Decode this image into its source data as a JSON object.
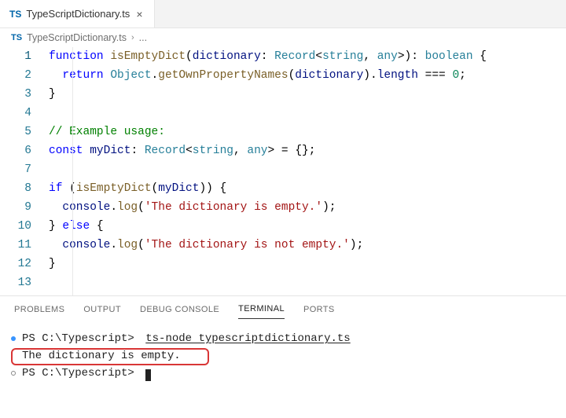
{
  "tab": {
    "icon_label": "TS",
    "filename": "TypeScriptDictionary.ts"
  },
  "breadcrumb": {
    "icon_label": "TS",
    "filename": "TypeScriptDictionary.ts",
    "tail": "..."
  },
  "gutter_lines": [
    "1",
    "2",
    "3",
    "4",
    "5",
    "6",
    "7",
    "8",
    "9",
    "10",
    "11",
    "12",
    "13"
  ],
  "code": {
    "l1": {
      "kw1": "function",
      "sp": " ",
      "fn": "isEmptyDict",
      "open": "(",
      "param": "dictionary",
      "colon": ": ",
      "typeA": "Record",
      "lt": "<",
      "str": "string",
      "comma": ", ",
      "any": "any",
      "gt": ">",
      "close": ")",
      "colon2": ": ",
      "ret": "boolean",
      "brace": " {"
    },
    "l2": {
      "indent": "  ",
      "kw": "return",
      "sp": " ",
      "obj": "Object",
      "dot": ".",
      "m1": "getOwnPropertyNames",
      "open": "(",
      "arg": "dictionary",
      "close": ")",
      "dot2": ".",
      "prop": "length",
      "eq": " === ",
      "num": "0",
      "semi": ";"
    },
    "l3": {
      "brace": "}"
    },
    "l5": {
      "comment": "// Example usage:"
    },
    "l6": {
      "kw": "const",
      "sp": " ",
      "name": "myDict",
      "colon": ": ",
      "typeA": "Record",
      "lt": "<",
      "str": "string",
      "comma": ", ",
      "any": "any",
      "gt": ">",
      "eq": " = ",
      "obj": "{}",
      "semi": ";"
    },
    "l8": {
      "kw": "if",
      "sp": " ",
      "open": "(",
      "fn": "isEmptyDict",
      "o2": "(",
      "arg": "myDict",
      "c2": ")",
      "close": ")",
      "brace": " {"
    },
    "l9": {
      "obj": "console",
      "dot": ".",
      "m": "log",
      "open": "(",
      "str": "'The dictionary is empty.'",
      "close": ")",
      "semi": ";"
    },
    "l10": {
      "close": "}",
      "sp": " ",
      "kw": "else",
      "brace": " {"
    },
    "l11": {
      "obj": "console",
      "dot": ".",
      "m": "log",
      "open": "(",
      "str": "'The dictionary is not empty.'",
      "close": ")",
      "semi": ";"
    },
    "l12": {
      "brace": "}"
    }
  },
  "panel": {
    "tabs": {
      "problems": "PROBLEMS",
      "output": "OUTPUT",
      "debug": "DEBUG CONSOLE",
      "terminal": "TERMINAL",
      "ports": "PORTS"
    }
  },
  "terminal": {
    "line1_prefix": "PS C:\\Typescript> ",
    "line1_cmd": "ts-node typescriptdictionary.ts",
    "line2": "The dictionary is empty.",
    "line3": "PS C:\\Typescript> "
  }
}
